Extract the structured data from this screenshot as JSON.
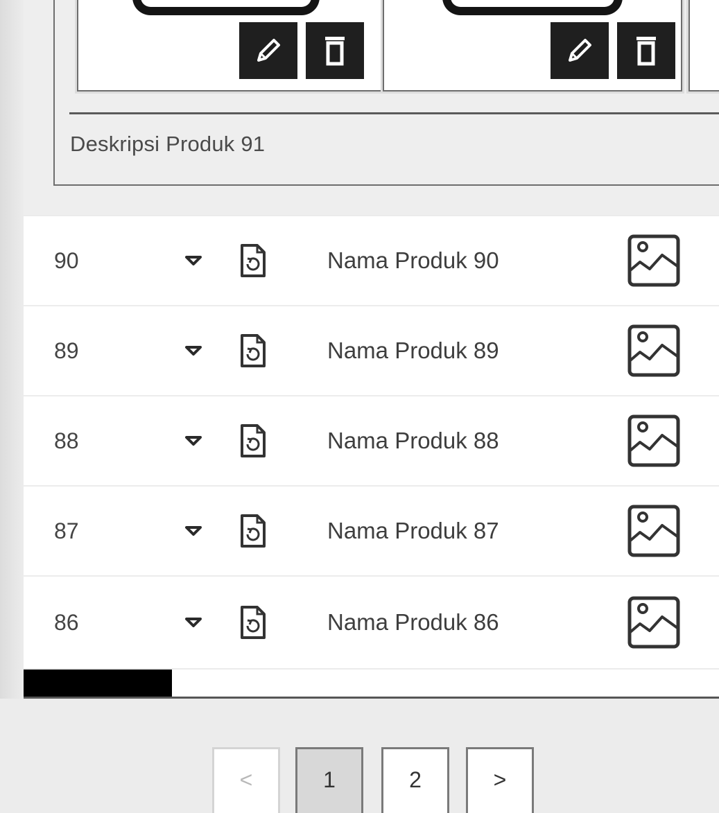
{
  "detail": {
    "description": "Deskripsi Produk 91",
    "images": [
      {
        "edit_icon": "pencil-icon",
        "delete_icon": "trash-icon"
      },
      {
        "edit_icon": "pencil-icon",
        "delete_icon": "trash-icon"
      }
    ]
  },
  "rows": [
    {
      "id": "90",
      "name": "Nama Produk 90"
    },
    {
      "id": "89",
      "name": "Nama Produk 89"
    },
    {
      "id": "88",
      "name": "Nama Produk 88"
    },
    {
      "id": "87",
      "name": "Nama Produk 87"
    },
    {
      "id": "86",
      "name": "Nama Produk 86"
    }
  ],
  "row_icons": {
    "toggle": "caret-down-icon",
    "document": "document-refresh-icon",
    "image": "image-icon"
  },
  "pagination": {
    "prev": "<",
    "pages": [
      "1",
      "2"
    ],
    "current": "1",
    "next": ">"
  },
  "colors": {
    "panel_bg": "#eeeeee",
    "row_bg": "#ffffff",
    "tool_button_bg": "#1f1f1f",
    "active_page_bg": "#d8d8d8",
    "scroll_thumb": "#000000"
  }
}
